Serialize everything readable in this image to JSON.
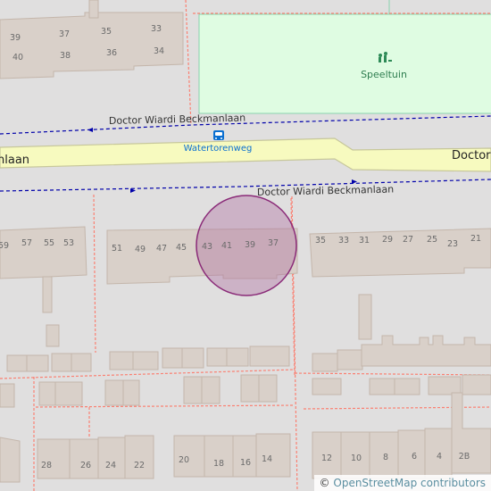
{
  "map": {
    "colors": {
      "background": "#e0dfdf",
      "building": "#d9d0c9",
      "building_stroke": "#c4b6ab",
      "road_main": "#f7fabf",
      "road_main_casing": "#c7c79b",
      "path_red": "#fa8072",
      "route_blue": "#0000aa",
      "playground": "#dffce2",
      "playground_stroke": "#8ad3af",
      "marker_fill": "#b06ea0",
      "marker_stroke": "#8a2a78"
    },
    "labels": {
      "street_top": "Doctor Wiardi Beckmanlaan",
      "street_bottom": "Doctor Wiardi Beckmanlaan",
      "main_road_left": "nlaan",
      "main_road_right": "Doctor W",
      "bus_stop": "Watertorenweg",
      "playground": "Speeltuin"
    },
    "house_numbers": {
      "top_left_row1": [
        "39",
        "37",
        "35",
        "33"
      ],
      "top_left_row2": [
        "40",
        "38",
        "36",
        "34"
      ],
      "middle_left": [
        "59",
        "57",
        "55",
        "53"
      ],
      "middle_center": [
        "51",
        "49",
        "47",
        "45",
        "43",
        "41",
        "39",
        "37"
      ],
      "middle_right": [
        "35",
        "33",
        "31",
        "29",
        "27",
        "25",
        "23",
        "21"
      ],
      "bottom_left": [
        "28",
        "26",
        "24",
        "22"
      ],
      "bottom_center": [
        "20",
        "18",
        "16",
        "14"
      ],
      "bottom_right": [
        "12",
        "10",
        "8",
        "6",
        "4",
        "2B"
      ]
    },
    "icons": {
      "bus_stop": "bus-stop-icon",
      "playground": "playground-icon"
    },
    "attribution": {
      "prefix": "© ",
      "link": "OpenStreetMap contributors"
    }
  }
}
